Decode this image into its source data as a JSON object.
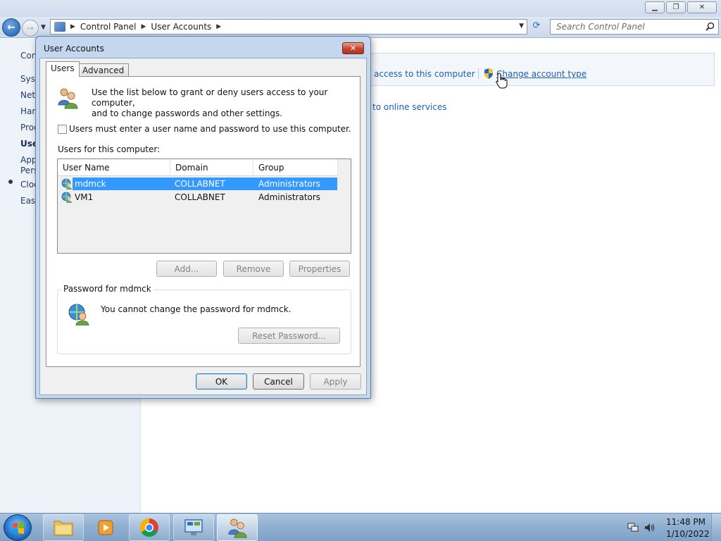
{
  "explorer": {
    "breadcrumb": [
      "Control Panel",
      "User Accounts"
    ],
    "search_placeholder": "Search Control Panel",
    "sidebar_items": [
      "Con",
      "Syst",
      "Netv",
      "Harc",
      "Prog",
      "Use",
      "App",
      "Pers",
      "Cloc",
      "Ease"
    ],
    "task_links": {
      "users_access": "rs access to this computer",
      "change_account_type": "Change account type",
      "online_services": "to online services"
    }
  },
  "dialog": {
    "title": "User Accounts",
    "tabs": [
      "Users",
      "Advanced"
    ],
    "intro": "Use the list below to grant or deny users access to your computer,\nand to change passwords and other settings.",
    "checkbox_label": "Users must enter a user name and password to use this computer.",
    "checkbox_checked": false,
    "list_label": "Users for this computer:",
    "columns": [
      "User Name",
      "Domain",
      "Group"
    ],
    "users": [
      {
        "name": "mdmck",
        "domain": "COLLABNET",
        "group": "Administrators",
        "selected": true
      },
      {
        "name": "VM1",
        "domain": "COLLABNET",
        "group": "Administrators",
        "selected": false
      }
    ],
    "buttons": {
      "add": "Add...",
      "remove": "Remove",
      "properties": "Properties"
    },
    "password_group_title": "Password for mdmck",
    "password_text": "You cannot change the password for mdmck.",
    "reset_password": "Reset Password...",
    "ok": "OK",
    "cancel": "Cancel",
    "apply": "Apply",
    "close_glyph": "✕"
  },
  "taskbar": {
    "time": "11:48 PM",
    "date": "1/10/2022",
    "apps": [
      "file-explorer",
      "media-player",
      "chrome",
      "remote-desktop",
      "user-accounts"
    ]
  },
  "colors": {
    "selection": "#3399ff",
    "link": "#1a5fb4",
    "close_red": "#c3452b"
  }
}
